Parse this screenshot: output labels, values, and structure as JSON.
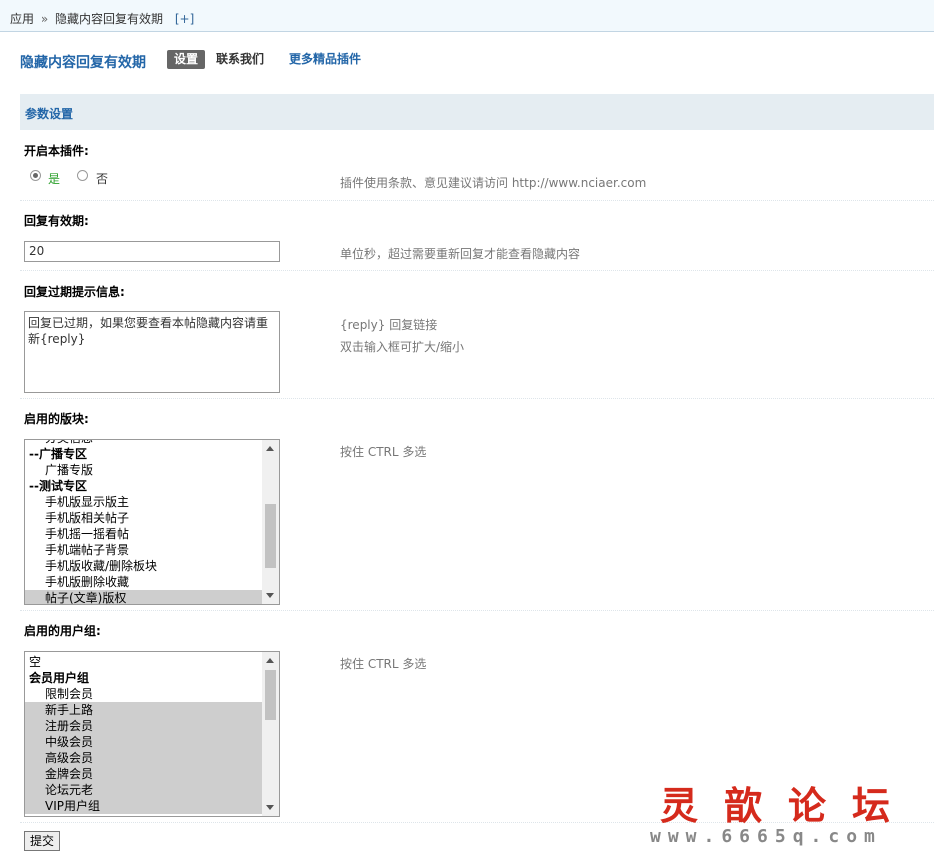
{
  "breadcrumb": {
    "root": "应用",
    "separator": "»",
    "current": "隐藏内容回复有效期",
    "add": "[+]"
  },
  "plugin_nav": {
    "title": "隐藏内容回复有效期",
    "tabs": [
      {
        "label": "设置",
        "active": true
      },
      {
        "label": "联系我们",
        "active": false
      },
      {
        "label": "更多精品插件",
        "active": false
      }
    ]
  },
  "section": {
    "title": "参数设置"
  },
  "fields": {
    "enable": {
      "label": "开启本插件:",
      "options": [
        "是",
        "否"
      ],
      "selected": "是",
      "hint": "插件使用条款、意见建议请访问 http://www.nciaer.com"
    },
    "validity": {
      "label": "回复有效期:",
      "value": "20",
      "hint": "单位秒，超过需要重新回复才能查看隐藏内容"
    },
    "expired_msg": {
      "label": "回复过期提示信息:",
      "value": "回复已过期，如果您要查看本帖隐藏内容请重新{reply}",
      "hint1": "{reply} 回复链接",
      "hint2": "双击输入框可扩大/缩小"
    },
    "forums": {
      "label": "启用的版块:",
      "hint": "按住 CTRL 多选",
      "options": [
        {
          "text": "分类信息",
          "type": "sub",
          "selected": false
        },
        {
          "text": "--广播专区",
          "type": "grp",
          "selected": false
        },
        {
          "text": "广播专版",
          "type": "sub",
          "selected": false
        },
        {
          "text": "--测试专区",
          "type": "grp",
          "selected": false
        },
        {
          "text": "手机版显示版主",
          "type": "sub",
          "selected": false
        },
        {
          "text": "手机版相关帖子",
          "type": "sub",
          "selected": false
        },
        {
          "text": "手机摇一摇看帖",
          "type": "sub",
          "selected": false
        },
        {
          "text": "手机端帖子背景",
          "type": "sub",
          "selected": false
        },
        {
          "text": "手机版收藏/删除板块",
          "type": "sub",
          "selected": false
        },
        {
          "text": "手机版删除收藏",
          "type": "sub",
          "selected": false
        },
        {
          "text": "帖子(文章)版权",
          "type": "sub",
          "selected": true
        }
      ]
    },
    "usergroups": {
      "label": "启用的用户组:",
      "hint": "按住 CTRL 多选",
      "options": [
        {
          "text": "空",
          "type": "plain",
          "selected": false
        },
        {
          "text": "会员用户组",
          "type": "grp",
          "selected": false
        },
        {
          "text": "限制会员",
          "type": "sub",
          "selected": false
        },
        {
          "text": "新手上路",
          "type": "sub",
          "selected": true
        },
        {
          "text": "注册会员",
          "type": "sub",
          "selected": true
        },
        {
          "text": "中级会员",
          "type": "sub",
          "selected": true
        },
        {
          "text": "高级会员",
          "type": "sub",
          "selected": true
        },
        {
          "text": "金牌会员",
          "type": "sub",
          "selected": true
        },
        {
          "text": "论坛元老",
          "type": "sub",
          "selected": true
        },
        {
          "text": "VIP用户组",
          "type": "sub",
          "selected": true
        }
      ]
    }
  },
  "submit_label": "提交",
  "watermark": {
    "chars": "灵歆论坛",
    "url": "www.6665q.com"
  },
  "colors": {
    "link": "#2366a8",
    "header_bg": "#f2f9fd",
    "section_bg": "#e5edf2",
    "watermark_red": "#d52a1c"
  }
}
